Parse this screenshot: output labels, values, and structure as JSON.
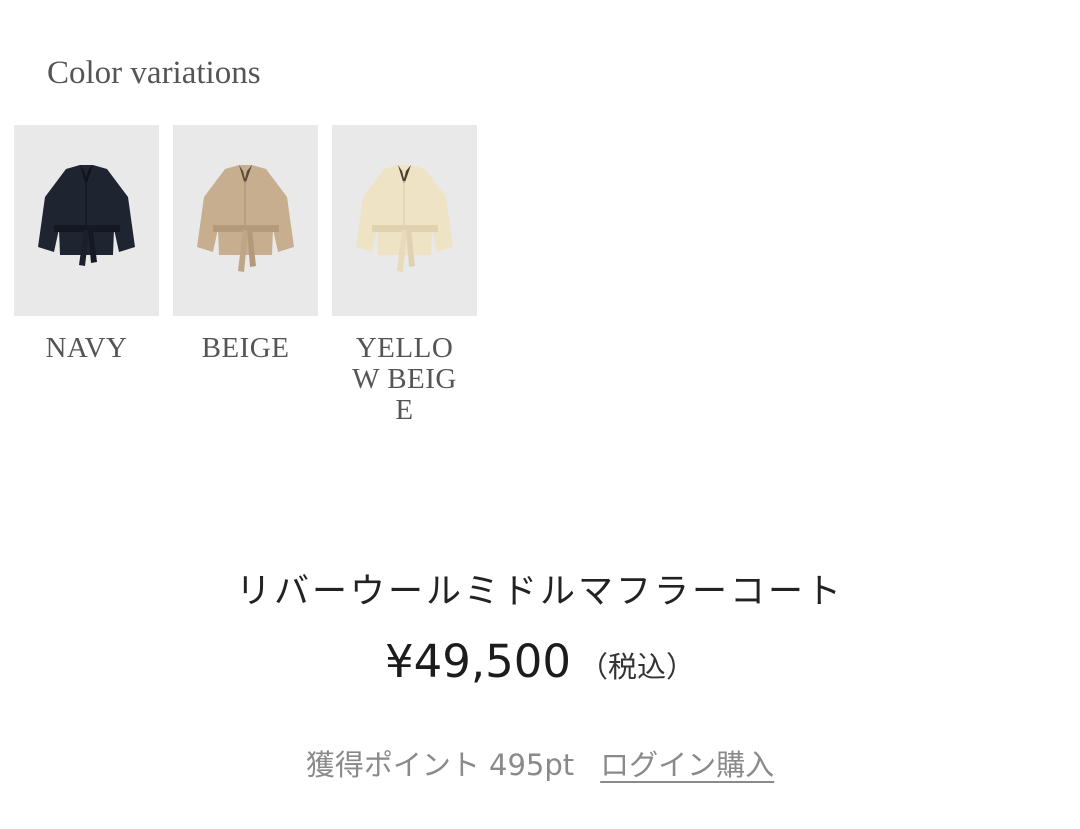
{
  "section": {
    "title": "Color variations"
  },
  "colors": [
    {
      "name": "NAVY",
      "body": "#1f2431",
      "shade": "#141824"
    },
    {
      "name": "BEIGE",
      "body": "#c7ae8e",
      "shade": "#b39a7b"
    },
    {
      "name": "YELLOW BEIGE",
      "body": "#efe3c6",
      "shade": "#e0d2b1"
    }
  ],
  "product": {
    "name": "リバーウールミドルマフラーコート",
    "price": "¥49,500",
    "tax_note": "（税込）",
    "points_label": "獲得ポイント 495pt",
    "login_link": "ログイン購入"
  }
}
